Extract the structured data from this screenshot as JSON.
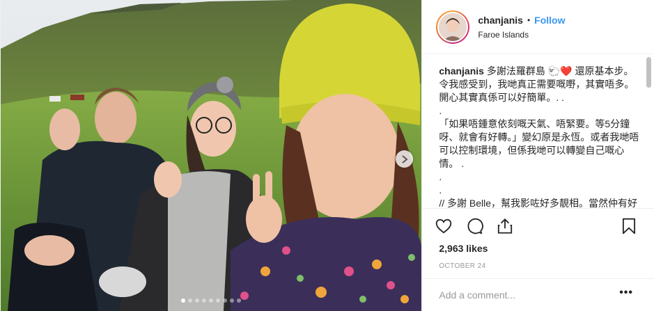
{
  "post": {
    "username": "chanjanis",
    "follow_label": "Follow",
    "separator": "•",
    "location": "Faroe Islands",
    "caption": {
      "user": "chanjanis",
      "text": " 多謝法羅群島 🐑❤️ 還原基本步。令我感受到，我哋真正需要嘅嘢，其實唔多。開心其實真係可以好簡單。. .\n.\n「如果唔鍾意依刻嘅天氣、唔緊要。等5分鐘呀、就會有好轉。」變幻原是永恆。或者我哋唔可以控制環境，但係我哋可以轉變自己嘅心情。 .\n.\n.\n// 多謝 Belle，幫我影咗好多靚相。當然仲有好多美好嘅回憶，印在嗰心裏面。"
    },
    "likes": "2,963 likes",
    "date": "OCTOBER 24",
    "comment_placeholder": "Add a comment...",
    "more_label": "•••",
    "carousel": {
      "total": 9,
      "active_index": 0
    }
  },
  "icons": {
    "like": "heart-icon",
    "comment": "comment-icon",
    "share": "share-icon",
    "save": "bookmark-icon",
    "next": "chevron-right-icon"
  },
  "colors": {
    "accent": "#3897f0",
    "text": "#262626",
    "muted": "#999999",
    "border": "#efefef"
  }
}
